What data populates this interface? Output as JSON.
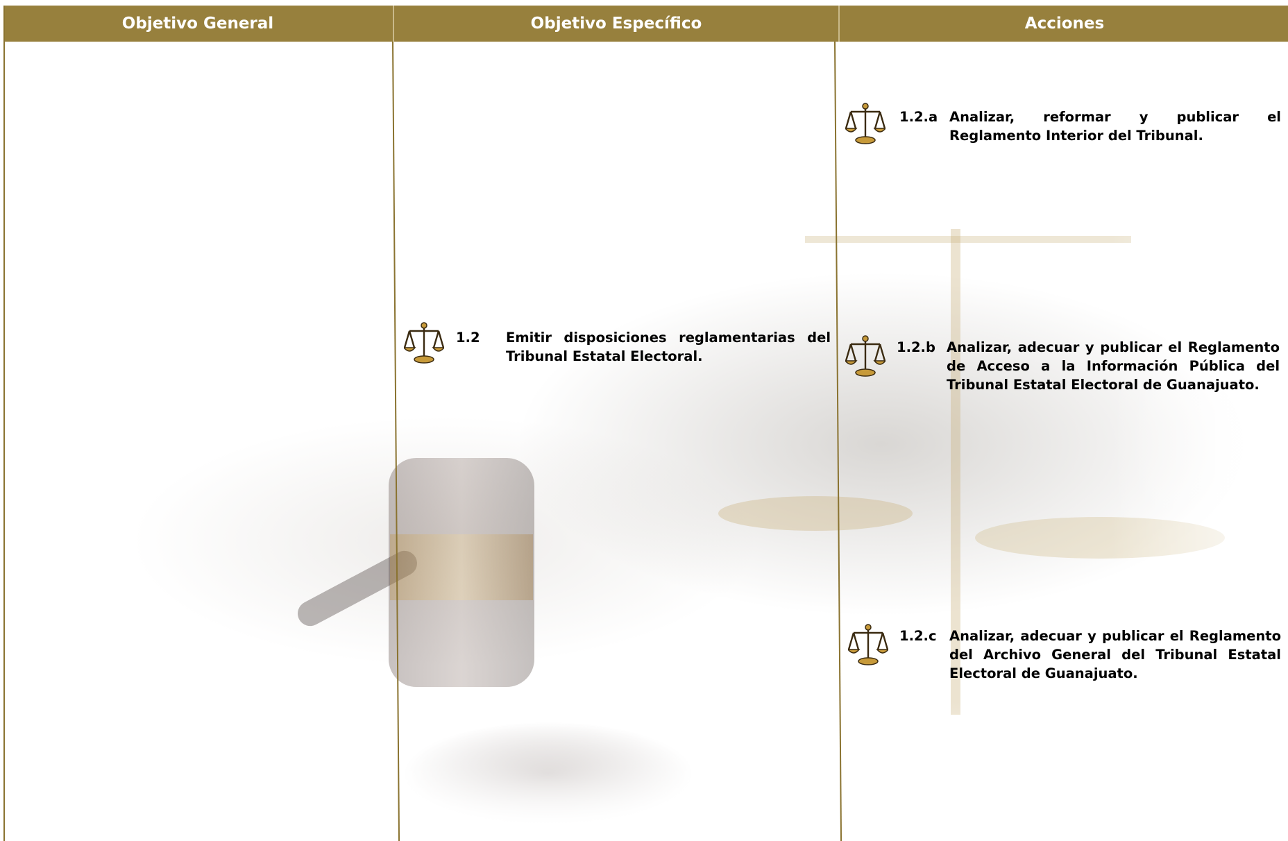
{
  "header": {
    "col1": "Objetivo General",
    "col2": "Objetivo Específico",
    "col3": "Acciones"
  },
  "colors": {
    "header_bg": "#97803d",
    "header_text": "#ffffff",
    "rule": "#8a7330"
  },
  "specific": {
    "number": "1.2",
    "text": "Emitir disposiciones reglamentarias del Tribunal Estatal Electoral.",
    "icon": "scales-of-justice-icon"
  },
  "actions": [
    {
      "number": "1.2.a",
      "text": "Analizar, reformar y publicar el Reglamento Interior del Tribunal.",
      "icon": "scales-of-justice-icon"
    },
    {
      "number": "1.2.b",
      "text": "Analizar, adecuar y publicar el Reglamento de Acceso a la Información Pública del Tribunal Estatal Electoral de Guanajuato.",
      "icon": "scales-of-justice-icon"
    },
    {
      "number": "1.2.c",
      "text": "Analizar, adecuar y publicar el Reglamento del Archivo General del Tribunal Estatal Electoral de Guanajuato.",
      "icon": "scales-of-justice-icon"
    }
  ]
}
